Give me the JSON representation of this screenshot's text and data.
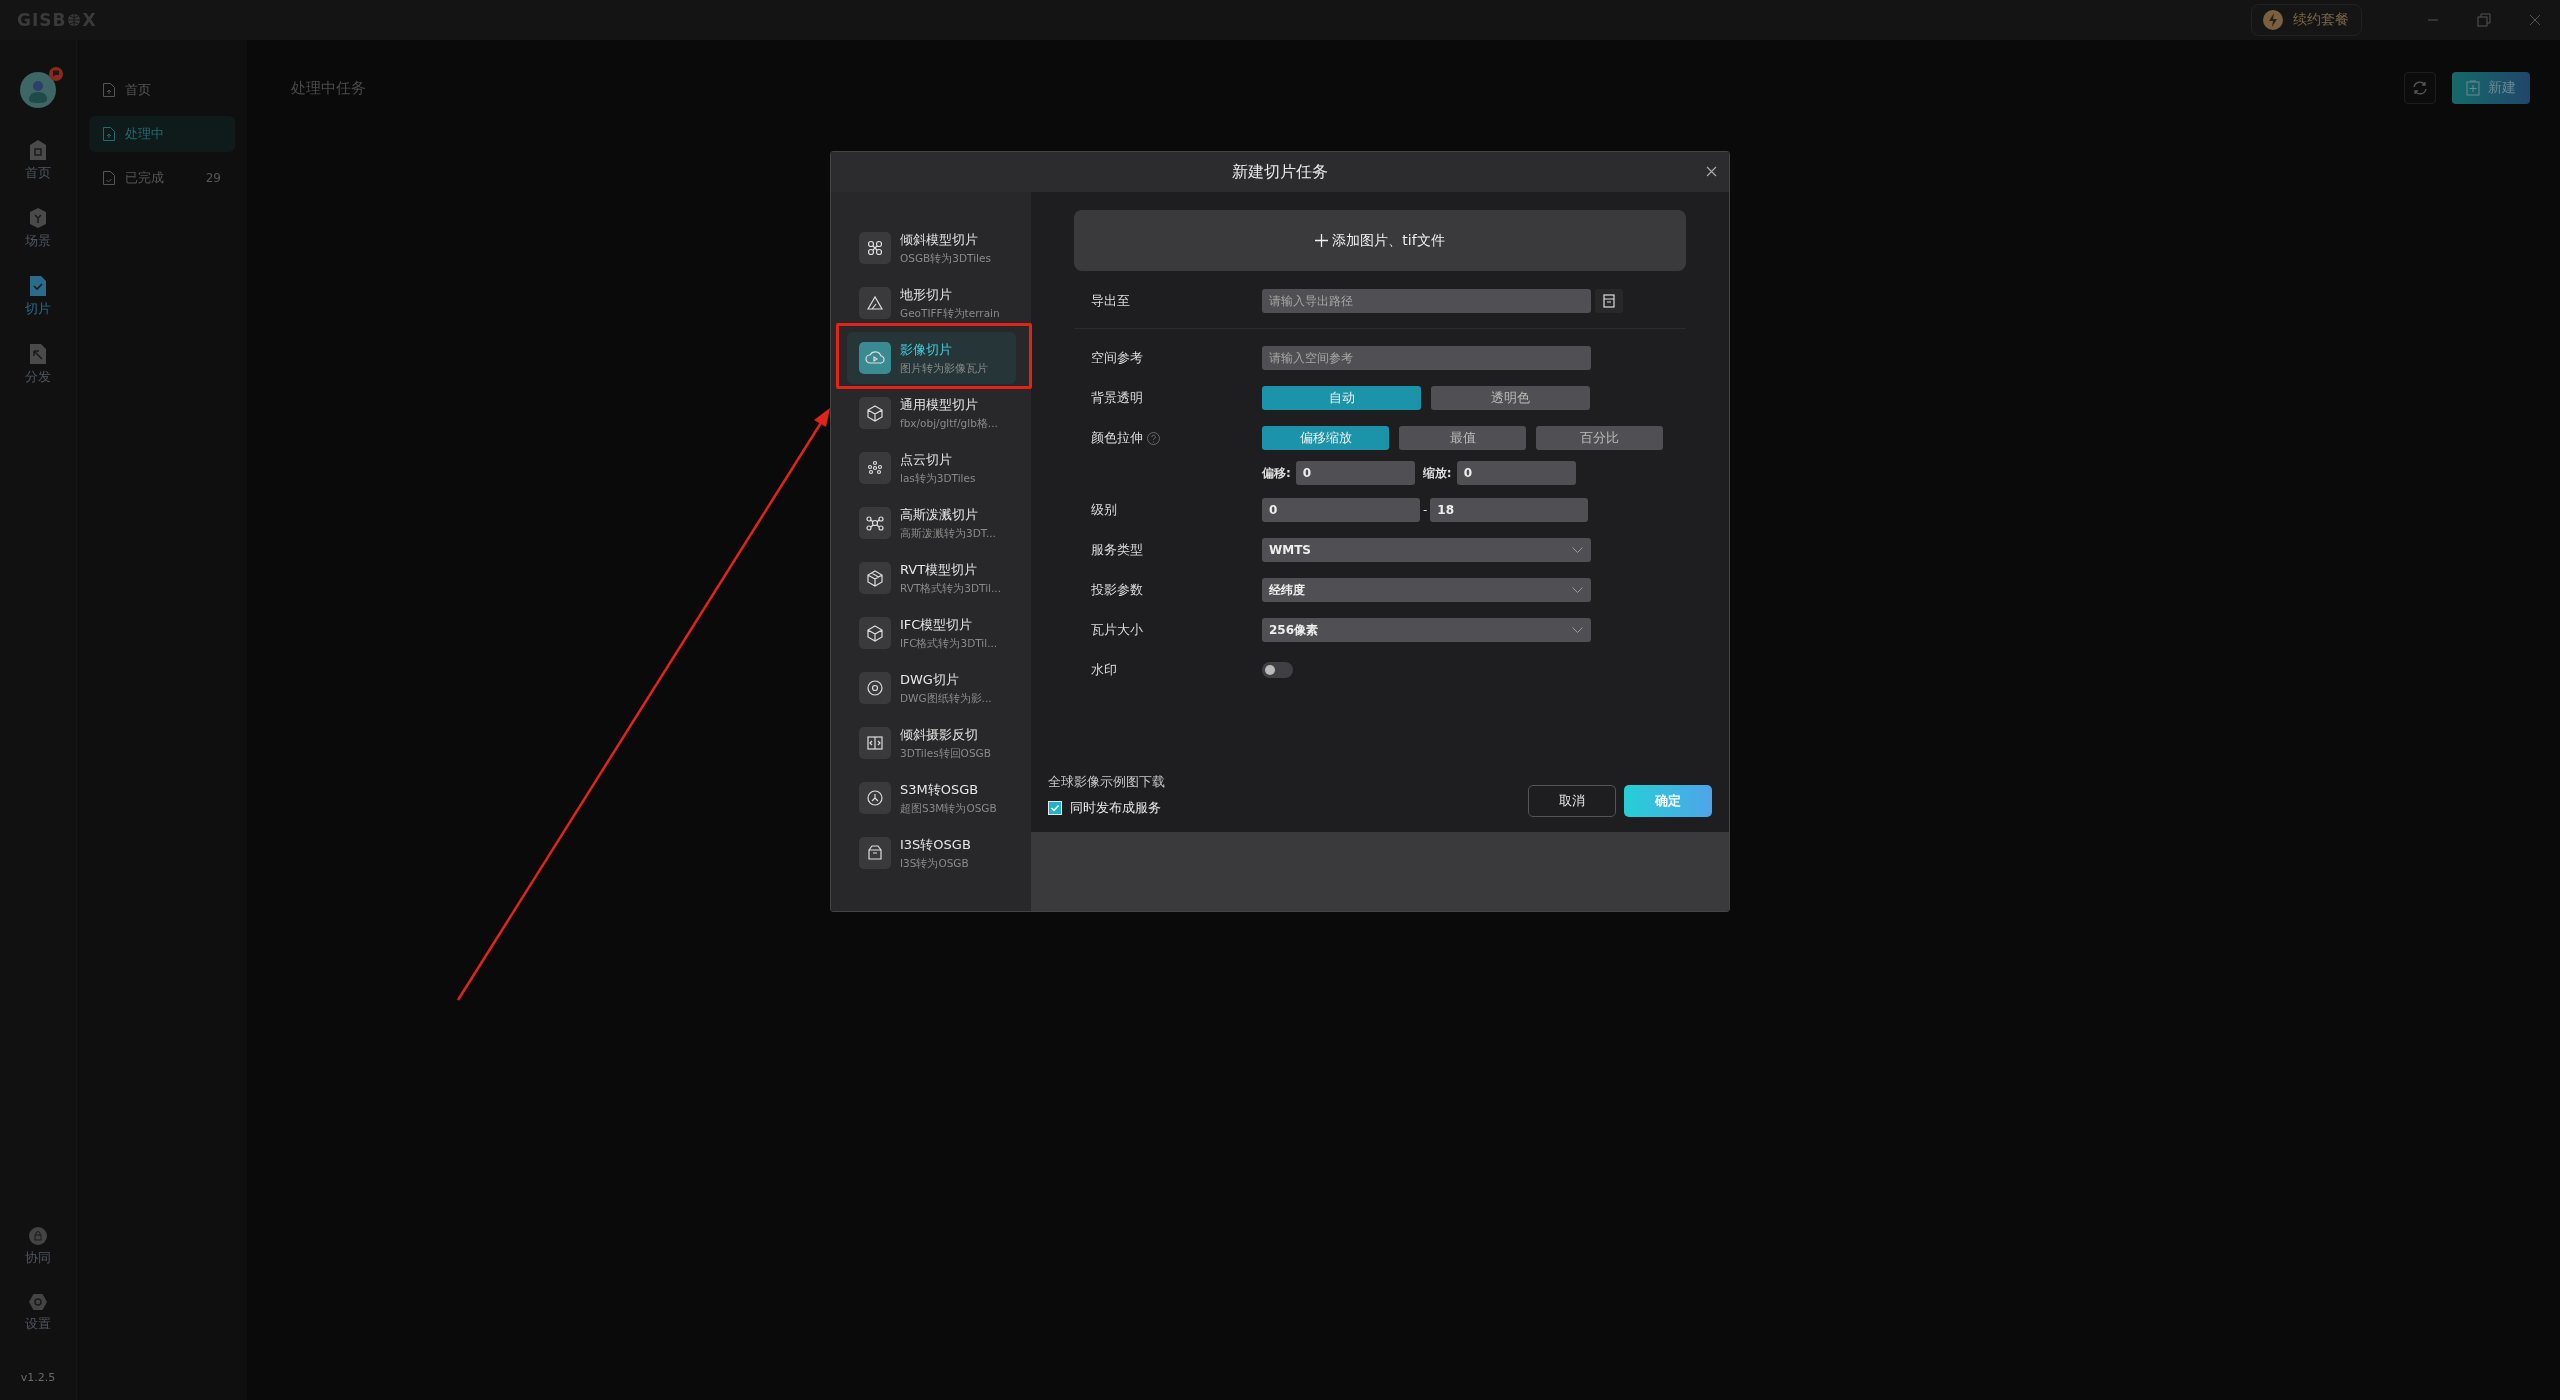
{
  "window": {
    "logo_left": "GISB",
    "logo_right": "X",
    "renew_button": "续约套餐"
  },
  "rail": {
    "top_items": [
      {
        "label": "首页",
        "selected": false
      },
      {
        "label": "场景",
        "selected": false
      },
      {
        "label": "切片",
        "selected": true
      },
      {
        "label": "分发",
        "selected": false
      }
    ],
    "bottom_items": [
      {
        "label": "协同",
        "selected": false
      },
      {
        "label": "设置",
        "selected": false
      }
    ],
    "version": "v1.2.5"
  },
  "subnav": {
    "items": [
      {
        "label": "首页",
        "selected": false
      },
      {
        "label": "处理中",
        "selected": true
      },
      {
        "label": "已完成",
        "selected": false,
        "count": "29"
      }
    ]
  },
  "page": {
    "title": "处理中任务",
    "new_button": "新建"
  },
  "dialog": {
    "title": "新建切片任务",
    "task_types": [
      {
        "title": "倾斜模型切片",
        "subtitle": "OSGB转为3DTiles",
        "selected": false
      },
      {
        "title": "地形切片",
        "subtitle": "GeoTIFF转为terrain",
        "selected": false
      },
      {
        "title": "影像切片",
        "subtitle": "图片转为影像瓦片",
        "selected": true
      },
      {
        "title": "通用模型切片",
        "subtitle": "fbx/obj/gltf/glb格...",
        "selected": false
      },
      {
        "title": "点云切片",
        "subtitle": "las转为3DTiles",
        "selected": false
      },
      {
        "title": "高斯泼溅切片",
        "subtitle": "高斯泼溅转为3DT...",
        "selected": false
      },
      {
        "title": "RVT模型切片",
        "subtitle": "RVT格式转为3DTil...",
        "selected": false
      },
      {
        "title": "IFC模型切片",
        "subtitle": "IFC格式转为3DTil...",
        "selected": false
      },
      {
        "title": "DWG切片",
        "subtitle": "DWG图纸转为影...",
        "selected": false
      },
      {
        "title": "倾斜摄影反切",
        "subtitle": "3DTiles转回OSGB",
        "selected": false
      },
      {
        "title": "S3M转OSGB",
        "subtitle": "超图S3M转为OSGB",
        "selected": false
      },
      {
        "title": "I3S转OSGB",
        "subtitle": "I3S转为OSGB",
        "selected": false
      }
    ],
    "add_button": "添加图片、tif文件",
    "export": {
      "label": "导出至",
      "placeholder": "请输入导出路径"
    },
    "fields": [
      {
        "kind": "text",
        "label": "空间参考",
        "placeholder": "请输入空间参考"
      },
      {
        "kind": "segmented",
        "label": "背景透明",
        "options": [
          {
            "label": "自动",
            "selected": true
          },
          {
            "label": "透明色",
            "selected": false
          }
        ]
      },
      {
        "kind": "segmented",
        "label": "颜色拉伸",
        "help": true,
        "options": [
          {
            "label": "偏移缩放",
            "selected": true
          },
          {
            "label": "最值",
            "selected": false
          },
          {
            "label": "百分比",
            "selected": false
          }
        ],
        "params": [
          {
            "label": "偏移:",
            "value": "0"
          },
          {
            "label": "缩放:",
            "value": "0"
          }
        ]
      },
      {
        "kind": "range",
        "label": "级别",
        "from": "0",
        "separator": "-",
        "to": "18"
      },
      {
        "kind": "select",
        "label": "服务类型",
        "value": "WMTS"
      },
      {
        "kind": "select",
        "label": "投影参数",
        "value": "经纬度"
      },
      {
        "kind": "select",
        "label": "瓦片大小",
        "value": "256像素"
      },
      {
        "kind": "toggle",
        "label": "水印",
        "on": false
      }
    ],
    "download_link": "全球影像示例图下载",
    "publish": {
      "label": "同时发布成服务",
      "checked": true
    },
    "cancel_button": "取消",
    "confirm_button": "确定"
  }
}
